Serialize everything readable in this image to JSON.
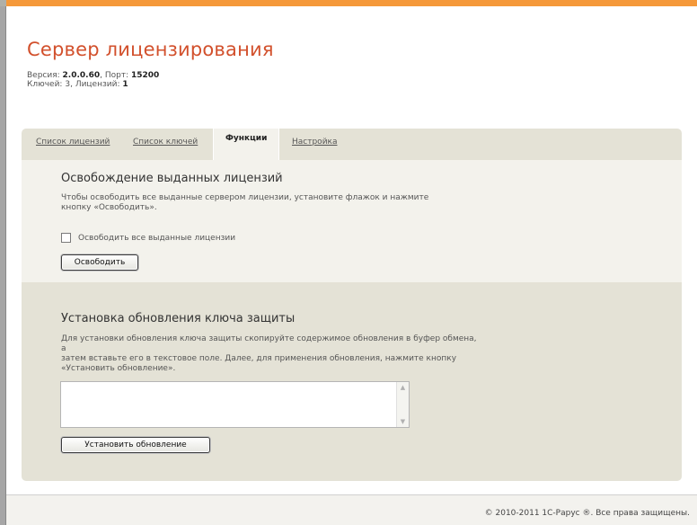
{
  "app": {
    "title": "Сервер лицензирования",
    "version_label": "Версия:",
    "version": "2.0.0.60",
    "port_label": "Порт:",
    "port": "15200",
    "keys_label": "Ключей:",
    "keys": "3",
    "licenses_label": "Лицензий:",
    "licenses": "1"
  },
  "tabs": [
    {
      "label": "Список лицензий",
      "active": false
    },
    {
      "label": "Список ключей",
      "active": false
    },
    {
      "label": "Функции",
      "active": true
    },
    {
      "label": "Настройка",
      "active": false
    }
  ],
  "release": {
    "title": "Освобождение выданных лицензий",
    "description": "Чтобы освободить все выданные сервером лицензии, установите флажок и нажмите кнопку «Освободить».",
    "checkbox_label": "Освободить все выданные лицензии",
    "checkbox_checked": false,
    "button_label": "Освободить"
  },
  "update": {
    "title": "Установка обновления ключа защиты",
    "description_line1": "Для установки обновления ключа защиты скопируйте содержимое обновления в буфер обмена, а",
    "description_line2": "затем вставьте его в текстовое поле. Далее, для применения обновления, нажмите кнопку",
    "description_line3": "«Установить обновление».",
    "textarea_value": "",
    "button_label": "Установить обновление"
  },
  "footer": {
    "copyright": "© 2010-2011 1С-Рарус ®. Все права защищены."
  },
  "colors": {
    "accent": "#f5993a",
    "title": "#d2502c",
    "panel": "#e4e2d6",
    "section": "#f3f2ec"
  }
}
